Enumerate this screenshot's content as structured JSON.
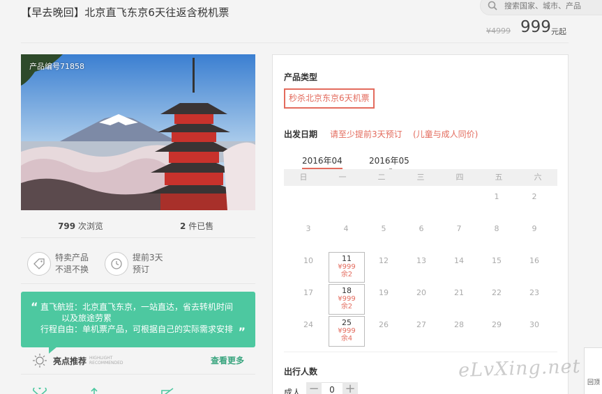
{
  "product": {
    "title": "【早去晚回】北京直飞东京6天往返含税机票",
    "id_label": "产品编号71858",
    "old_price": "¥4999",
    "price": "999",
    "price_unit": "元起"
  },
  "search": {
    "placeholder": "搜索国家、城市、产品"
  },
  "stats": {
    "views_count": "799",
    "views_label": "次浏览",
    "sold_count": "2",
    "sold_label": "件已售"
  },
  "features": [
    {
      "line1": "特卖产品",
      "line2": "不退不换",
      "icon": "tag-icon"
    },
    {
      "line1": "提前3天",
      "line2": "预订",
      "icon": "clock-icon"
    }
  ],
  "highlight": {
    "lines": [
      "直飞航班：北京直飞东京，一站直达，省去转机时间",
      "以及旅途劳累",
      "行程自由：单机票产品，可根据自己的实际需求安排"
    ],
    "label": "亮点推荐",
    "label_en_1": "HIGHLIGHT",
    "label_en_2": "RECOMMENDED",
    "more": "查看更多"
  },
  "booking": {
    "type_heading": "产品类型",
    "type_option": "秒杀北京东京6天机票",
    "date_heading": "出发日期",
    "date_note": "请至少提前3天预订",
    "date_note2": "(儿童与成人同价)",
    "months": [
      "2016年04",
      "2016年05"
    ],
    "weekdays": [
      "日",
      "一",
      "二",
      "三",
      "四",
      "五",
      "六"
    ],
    "calendar": [
      [
        null,
        null,
        null,
        null,
        null,
        {
          "d": "1"
        },
        {
          "d": "2"
        }
      ],
      [
        {
          "d": "3"
        },
        {
          "d": "4"
        },
        {
          "d": "5"
        },
        {
          "d": "6"
        },
        {
          "d": "7"
        },
        {
          "d": "8"
        },
        {
          "d": "9"
        }
      ],
      [
        {
          "d": "10"
        },
        {
          "d": "11",
          "price": "¥999",
          "remain": "余2"
        },
        {
          "d": "12"
        },
        {
          "d": "13"
        },
        {
          "d": "14"
        },
        {
          "d": "15"
        },
        {
          "d": "16"
        }
      ],
      [
        {
          "d": "17"
        },
        {
          "d": "18",
          "price": "¥999",
          "remain": "余2"
        },
        {
          "d": "19"
        },
        {
          "d": "20"
        },
        {
          "d": "21"
        },
        {
          "d": "22"
        },
        {
          "d": "23"
        }
      ],
      [
        {
          "d": "24"
        },
        {
          "d": "25",
          "price": "¥999",
          "remain": "余4"
        },
        {
          "d": "26"
        },
        {
          "d": "27"
        },
        {
          "d": "28"
        },
        {
          "d": "29"
        },
        {
          "d": "30"
        }
      ]
    ],
    "pax_heading": "出行人数",
    "adult_label": "成人",
    "adult_count": "0",
    "minus": "−",
    "plus": "+"
  },
  "watermark": "eLvXing.net",
  "back_top": "回顶",
  "colors": {
    "accent": "#e36b5d",
    "green": "#4dc8a0"
  }
}
